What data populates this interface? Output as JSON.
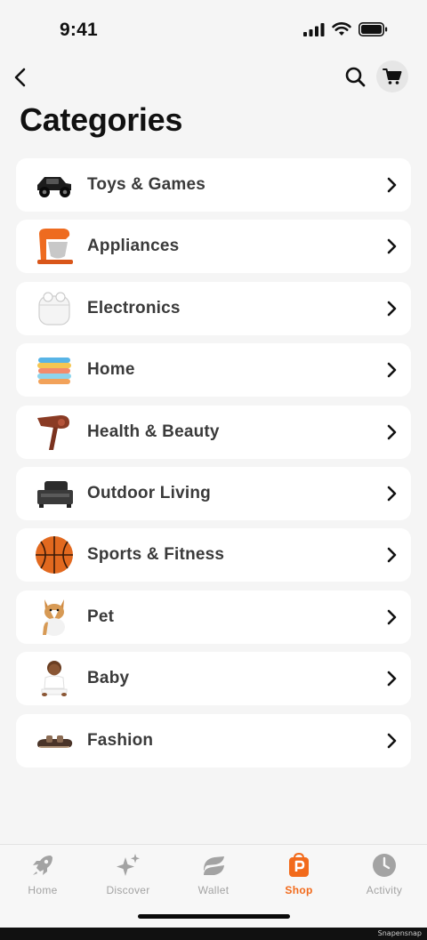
{
  "status_bar": {
    "time": "9:41"
  },
  "nav": {
    "back_icon": "chevron-left-icon",
    "search_icon": "search-icon",
    "cart_icon": "cart-icon"
  },
  "page_title": "Categories",
  "categories": [
    {
      "label": "Toys & Games",
      "icon": "toy-car-icon"
    },
    {
      "label": "Appliances",
      "icon": "stand-mixer-icon"
    },
    {
      "label": "Electronics",
      "icon": "earbuds-case-icon"
    },
    {
      "label": "Home",
      "icon": "towels-icon"
    },
    {
      "label": "Health & Beauty",
      "icon": "hair-dryer-icon"
    },
    {
      "label": "Outdoor Living",
      "icon": "grill-icon"
    },
    {
      "label": "Sports & Fitness",
      "icon": "basketball-icon"
    },
    {
      "label": "Pet",
      "icon": "dog-icon"
    },
    {
      "label": "Baby",
      "icon": "baby-icon"
    },
    {
      "label": "Fashion",
      "icon": "sandal-icon"
    }
  ],
  "tabs": [
    {
      "label": "Home",
      "icon": "rocket-icon",
      "active": false
    },
    {
      "label": "Discover",
      "icon": "sparkle-icon",
      "active": false
    },
    {
      "label": "Wallet",
      "icon": "wallet-icon",
      "active": false
    },
    {
      "label": "Shop",
      "icon": "shop-bag-icon",
      "active": true
    },
    {
      "label": "Activity",
      "icon": "clock-icon",
      "active": false
    }
  ],
  "colors": {
    "accent": "#f26a1b",
    "inactive": "#a3a3a3",
    "card": "#ffffff",
    "background": "#f5f5f5"
  },
  "watermark": "Snapensnap"
}
